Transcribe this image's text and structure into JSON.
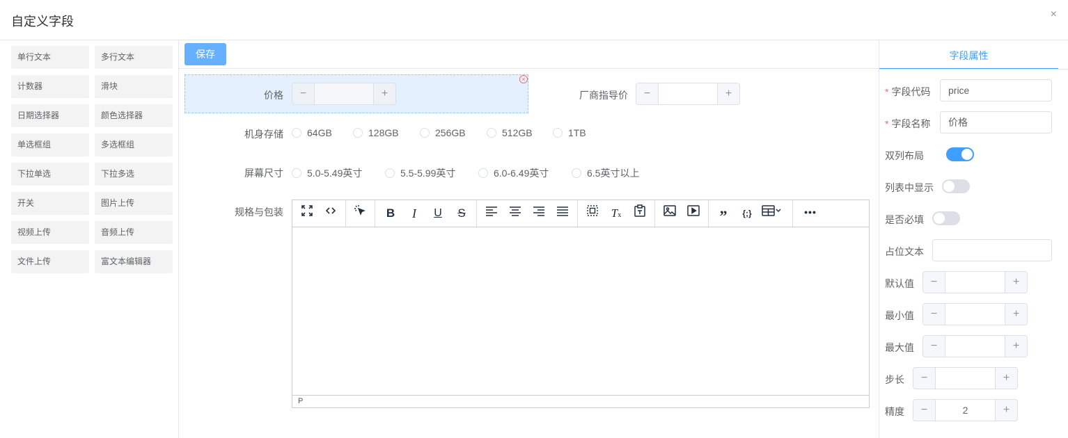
{
  "dialog": {
    "title": "自定义字段",
    "close_glyph": "×"
  },
  "palette": {
    "items": [
      "单行文本",
      "多行文本",
      "计数器",
      "滑块",
      "日期选择器",
      "颜色选择器",
      "单选框组",
      "多选框组",
      "下拉单选",
      "下拉多选",
      "开关",
      "图片上传",
      "视频上传",
      "音频上传",
      "文件上传",
      "富文本编辑器"
    ]
  },
  "toolbar": {
    "save_label": "保存"
  },
  "canvas": {
    "price": {
      "label": "价格",
      "value": ""
    },
    "msrp": {
      "label": "厂商指导价",
      "value": ""
    },
    "storage": {
      "label": "机身存储",
      "options": [
        "64GB",
        "128GB",
        "256GB",
        "512GB",
        "1TB"
      ]
    },
    "screen": {
      "label": "屏幕尺寸",
      "options": [
        "5.0-5.49英寸",
        "5.5-5.99英寸",
        "6.0-6.49英寸",
        "6.5英寸以上"
      ]
    },
    "spec": {
      "label": "规格与包装",
      "status_path": "P"
    }
  },
  "stepper_glyphs": {
    "minus": "−",
    "plus": "+"
  },
  "props": {
    "tab": "字段属性",
    "code": {
      "label": "字段代码",
      "value": "price"
    },
    "name": {
      "label": "字段名称",
      "value": "价格"
    },
    "two_col": {
      "label": "双列布局",
      "on": true
    },
    "show_in_list": {
      "label": "列表中显示",
      "on": false
    },
    "required": {
      "label": "是否必填",
      "on": false
    },
    "placeholder": {
      "label": "占位文本",
      "value": ""
    },
    "default": {
      "label": "默认值",
      "value": ""
    },
    "min": {
      "label": "最小值",
      "value": ""
    },
    "max": {
      "label": "最大值",
      "value": ""
    },
    "step": {
      "label": "步长",
      "value": ""
    },
    "precision": {
      "label": "精度",
      "value": "2"
    }
  },
  "colors": {
    "primary": "#409eff",
    "save_button": "#66b1ff",
    "selected_bg": "#e4f0fd",
    "danger": "#f56c6c"
  }
}
